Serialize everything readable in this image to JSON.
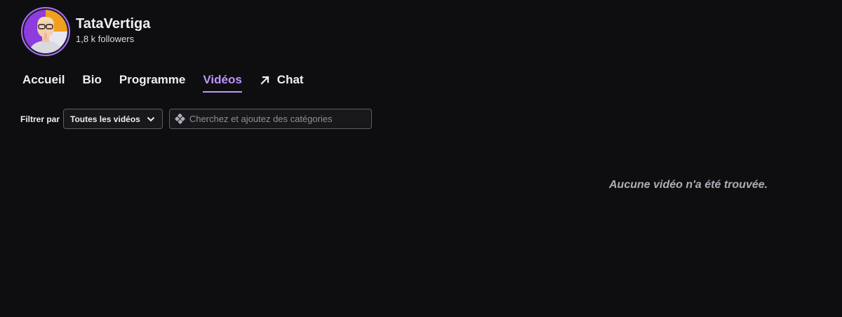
{
  "channel": {
    "name": "TataVertiga",
    "followers": "1,8 k followers"
  },
  "tabs": [
    {
      "label": "Accueil",
      "active": false
    },
    {
      "label": "Bio",
      "active": false
    },
    {
      "label": "Programme",
      "active": false
    },
    {
      "label": "Vidéos",
      "active": true
    },
    {
      "label": "Chat",
      "active": false,
      "icon": "external-arrow-icon"
    }
  ],
  "filter": {
    "label": "Filtrer par",
    "selected": "Toutes les vidéos",
    "search_placeholder": "Cherchez et ajoutez des catégories",
    "search_icon": "category-icon"
  },
  "empty_message": "Aucune vidéo n'a été trouvée.",
  "colors": {
    "background": "#0e0e10",
    "accent": "#bf94ff",
    "text": "#efeff1"
  }
}
